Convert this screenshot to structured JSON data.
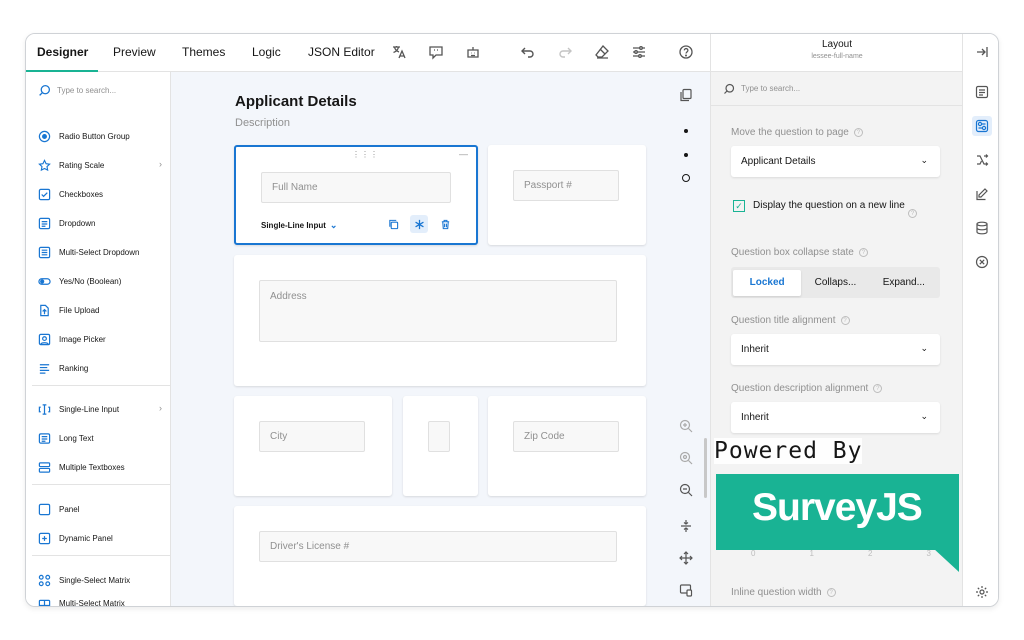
{
  "tabs": [
    "Designer",
    "Preview",
    "Themes",
    "Logic",
    "JSON Editor"
  ],
  "toolbox": {
    "search_placeholder": "Type to search...",
    "items": [
      {
        "label": "Radio Button Group",
        "icon": "radio-icon"
      },
      {
        "label": "Rating Scale",
        "icon": "star-icon"
      },
      {
        "label": "Checkboxes",
        "icon": "checkbox-icon"
      },
      {
        "label": "Dropdown",
        "icon": "dropdown-icon"
      },
      {
        "label": "Multi-Select Dropdown",
        "icon": "multi-dropdown-icon"
      },
      {
        "label": "Yes/No (Boolean)",
        "icon": "toggle-icon"
      },
      {
        "label": "File Upload",
        "icon": "file-icon"
      },
      {
        "label": "Image Picker",
        "icon": "image-icon"
      },
      {
        "label": "Ranking",
        "icon": "ranking-icon"
      },
      {
        "label": "Single-Line Input",
        "icon": "text-input-icon"
      },
      {
        "label": "Long Text",
        "icon": "long-text-icon"
      },
      {
        "label": "Multiple Textboxes",
        "icon": "multi-text-icon"
      },
      {
        "label": "Panel",
        "icon": "panel-icon"
      },
      {
        "label": "Dynamic Panel",
        "icon": "dynamic-panel-icon"
      },
      {
        "label": "Single-Select Matrix",
        "icon": "matrix-icon"
      },
      {
        "label": "Multi-Select Matrix",
        "icon": "multi-matrix-icon"
      }
    ]
  },
  "page": {
    "title": "Applicant Details",
    "description": "Description",
    "fields": {
      "full_name": "Full Name",
      "passport": "Passport #",
      "address": "Address",
      "city": "City",
      "zip": "Zip Code",
      "license": "Driver's License #"
    },
    "question_type": "Single-Line Input"
  },
  "properties": {
    "title": "Layout",
    "subtitle": "lessee-full-name",
    "search_placeholder": "Type to search...",
    "move_to_page_label": "Move the question to page",
    "move_to_page_value": "Applicant Details",
    "new_line_label": "Display the question on a new line",
    "collapse_label": "Question box collapse state",
    "collapse_options": [
      "Locked",
      "Collaps...",
      "Expand..."
    ],
    "title_align_label": "Question title alignment",
    "title_align_value": "Inherit",
    "desc_align_label": "Question description alignment",
    "desc_align_value": "Inherit",
    "scale_numbers": [
      "0",
      "1",
      "2",
      "3"
    ],
    "inline_width_label": "Inline question width"
  },
  "watermark": {
    "powered": "Powered By",
    "brand": "SurveyJS"
  },
  "colors": {
    "accent": "#19b394",
    "primary": "#1976d2"
  }
}
